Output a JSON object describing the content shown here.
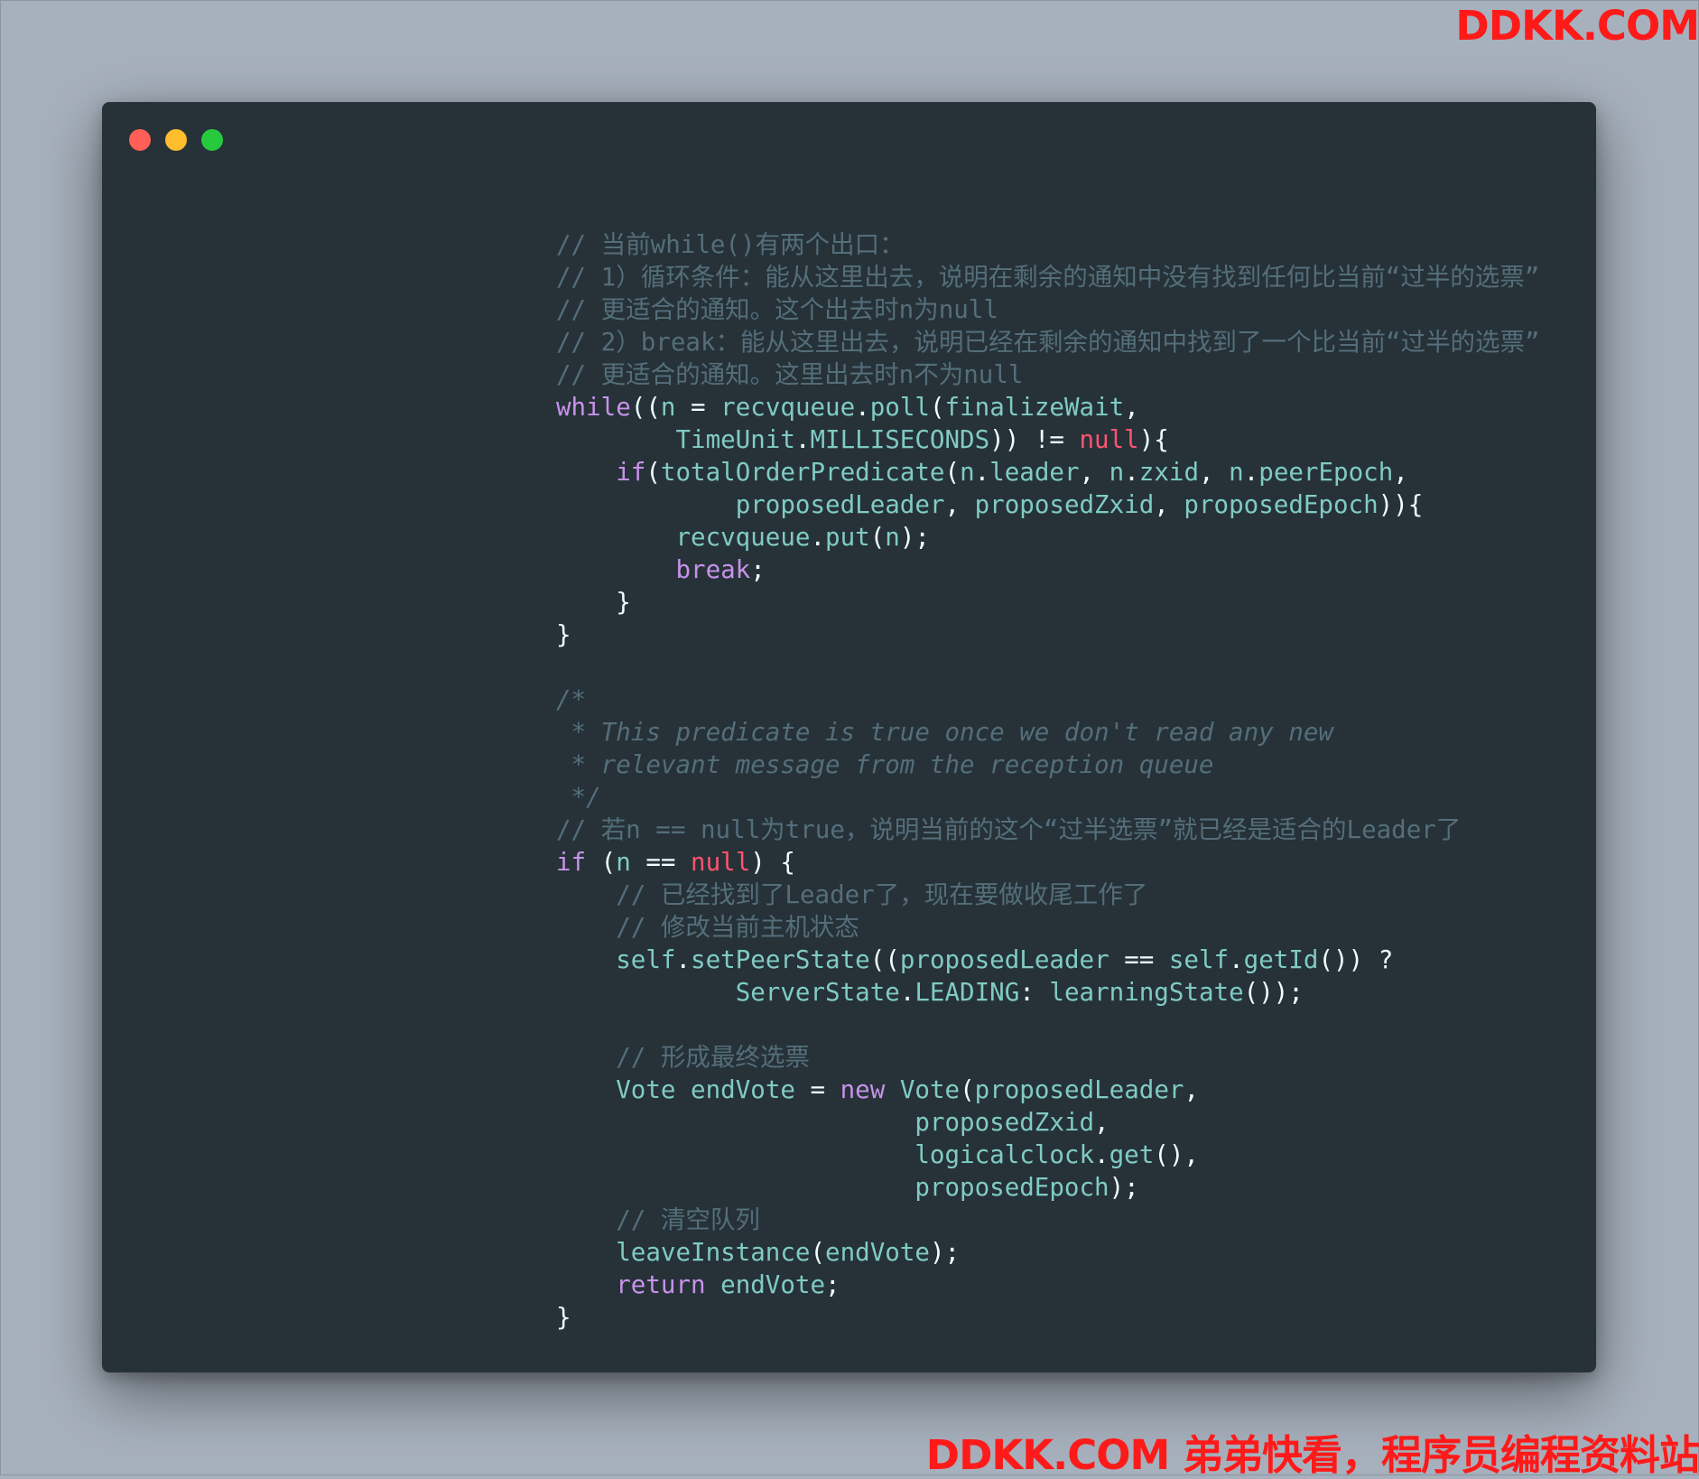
{
  "watermark": {
    "top": "DDKK.COM",
    "bottom": "DDKK.COM 弟弟快看，程序员编程资料站"
  },
  "window": {
    "background": "#263238",
    "traffic_lights": [
      "close",
      "minimize",
      "maximize"
    ]
  },
  "colors": {
    "comment": "#546e7a",
    "keyword": "#c792ea",
    "identifier": "#80cbc4",
    "null_literal": "#ff5370",
    "punctuation": "#eeffff"
  },
  "code_lines": [
    [
      {
        "t": "// 当前while()有两个出口：",
        "k": "c"
      }
    ],
    [
      {
        "t": "// 1）循环条件：能从这里出去，说明在剩余的通知中没有找到任何比当前“过半的选票”",
        "k": "c"
      }
    ],
    [
      {
        "t": "// 更适合的通知。这个出去时n为null",
        "k": "c"
      }
    ],
    [
      {
        "t": "// 2）break：能从这里出去，说明已经在剩余的通知中找到了一个比当前“过半的选票”",
        "k": "c"
      }
    ],
    [
      {
        "t": "// 更适合的通知。这里出去时n不为null",
        "k": "c"
      }
    ],
    [
      {
        "t": "while",
        "k": "kw"
      },
      {
        "t": "((",
        "k": "pn"
      },
      {
        "t": "n",
        "k": "id"
      },
      {
        "t": " = ",
        "k": "pn"
      },
      {
        "t": "recvqueue",
        "k": "id"
      },
      {
        "t": ".",
        "k": "pn"
      },
      {
        "t": "poll",
        "k": "id"
      },
      {
        "t": "(",
        "k": "pn"
      },
      {
        "t": "finalizeWait",
        "k": "id"
      },
      {
        "t": ",",
        "k": "pn"
      }
    ],
    [
      {
        "t": "        ",
        "k": "pn"
      },
      {
        "t": "TimeUnit",
        "k": "id"
      },
      {
        "t": ".",
        "k": "pn"
      },
      {
        "t": "MILLISECONDS",
        "k": "id"
      },
      {
        "t": ")) != ",
        "k": "pn"
      },
      {
        "t": "null",
        "k": "nl"
      },
      {
        "t": "){",
        "k": "pn"
      }
    ],
    [
      {
        "t": "    ",
        "k": "pn"
      },
      {
        "t": "if",
        "k": "kw"
      },
      {
        "t": "(",
        "k": "pn"
      },
      {
        "t": "totalOrderPredicate",
        "k": "id"
      },
      {
        "t": "(",
        "k": "pn"
      },
      {
        "t": "n",
        "k": "id"
      },
      {
        "t": ".",
        "k": "pn"
      },
      {
        "t": "leader",
        "k": "id"
      },
      {
        "t": ", ",
        "k": "pn"
      },
      {
        "t": "n",
        "k": "id"
      },
      {
        "t": ".",
        "k": "pn"
      },
      {
        "t": "zxid",
        "k": "id"
      },
      {
        "t": ", ",
        "k": "pn"
      },
      {
        "t": "n",
        "k": "id"
      },
      {
        "t": ".",
        "k": "pn"
      },
      {
        "t": "peerEpoch",
        "k": "id"
      },
      {
        "t": ",",
        "k": "pn"
      }
    ],
    [
      {
        "t": "            ",
        "k": "pn"
      },
      {
        "t": "proposedLeader",
        "k": "id"
      },
      {
        "t": ", ",
        "k": "pn"
      },
      {
        "t": "proposedZxid",
        "k": "id"
      },
      {
        "t": ", ",
        "k": "pn"
      },
      {
        "t": "proposedEpoch",
        "k": "id"
      },
      {
        "t": ")){",
        "k": "pn"
      }
    ],
    [
      {
        "t": "        ",
        "k": "pn"
      },
      {
        "t": "recvqueue",
        "k": "id"
      },
      {
        "t": ".",
        "k": "pn"
      },
      {
        "t": "put",
        "k": "id"
      },
      {
        "t": "(",
        "k": "pn"
      },
      {
        "t": "n",
        "k": "id"
      },
      {
        "t": ");",
        "k": "pn"
      }
    ],
    [
      {
        "t": "        ",
        "k": "pn"
      },
      {
        "t": "break",
        "k": "kw"
      },
      {
        "t": ";",
        "k": "pn"
      }
    ],
    [
      {
        "t": "    }",
        "k": "pn"
      }
    ],
    [
      {
        "t": "}",
        "k": "pn"
      }
    ],
    [],
    [
      {
        "t": "/*",
        "k": "c-it"
      }
    ],
    [
      {
        "t": " * This predicate is true once we don't read any new",
        "k": "c-it"
      }
    ],
    [
      {
        "t": " * relevant message from the reception queue",
        "k": "c-it"
      }
    ],
    [
      {
        "t": " */",
        "k": "c-it"
      }
    ],
    [
      {
        "t": "// 若n == null为true，说明当前的这个“过半选票”就已经是适合的Leader了",
        "k": "c"
      }
    ],
    [
      {
        "t": "if",
        "k": "kw"
      },
      {
        "t": " (",
        "k": "pn"
      },
      {
        "t": "n",
        "k": "id"
      },
      {
        "t": " == ",
        "k": "pn"
      },
      {
        "t": "null",
        "k": "nl"
      },
      {
        "t": ") {",
        "k": "pn"
      }
    ],
    [
      {
        "t": "    ",
        "k": "pn"
      },
      {
        "t": "// 已经找到了Leader了，现在要做收尾工作了",
        "k": "c"
      }
    ],
    [
      {
        "t": "    ",
        "k": "pn"
      },
      {
        "t": "// 修改当前主机状态",
        "k": "c"
      }
    ],
    [
      {
        "t": "    ",
        "k": "pn"
      },
      {
        "t": "self",
        "k": "id"
      },
      {
        "t": ".",
        "k": "pn"
      },
      {
        "t": "setPeerState",
        "k": "id"
      },
      {
        "t": "((",
        "k": "pn"
      },
      {
        "t": "proposedLeader",
        "k": "id"
      },
      {
        "t": " == ",
        "k": "pn"
      },
      {
        "t": "self",
        "k": "id"
      },
      {
        "t": ".",
        "k": "pn"
      },
      {
        "t": "getId",
        "k": "id"
      },
      {
        "t": "()) ?",
        "k": "pn"
      }
    ],
    [
      {
        "t": "            ",
        "k": "pn"
      },
      {
        "t": "ServerState",
        "k": "id"
      },
      {
        "t": ".",
        "k": "pn"
      },
      {
        "t": "LEADING",
        "k": "id"
      },
      {
        "t": ": ",
        "k": "pn"
      },
      {
        "t": "learningState",
        "k": "id"
      },
      {
        "t": "());",
        "k": "pn"
      }
    ],
    [],
    [
      {
        "t": "    ",
        "k": "pn"
      },
      {
        "t": "// 形成最终选票",
        "k": "c"
      }
    ],
    [
      {
        "t": "    ",
        "k": "pn"
      },
      {
        "t": "Vote",
        "k": "id"
      },
      {
        "t": " ",
        "k": "pn"
      },
      {
        "t": "endVote",
        "k": "id"
      },
      {
        "t": " = ",
        "k": "pn"
      },
      {
        "t": "new",
        "k": "kw"
      },
      {
        "t": " ",
        "k": "pn"
      },
      {
        "t": "Vote",
        "k": "id"
      },
      {
        "t": "(",
        "k": "pn"
      },
      {
        "t": "proposedLeader",
        "k": "id"
      },
      {
        "t": ",",
        "k": "pn"
      }
    ],
    [
      {
        "t": "                        ",
        "k": "pn"
      },
      {
        "t": "proposedZxid",
        "k": "id"
      },
      {
        "t": ",",
        "k": "pn"
      }
    ],
    [
      {
        "t": "                        ",
        "k": "pn"
      },
      {
        "t": "logicalclock",
        "k": "id"
      },
      {
        "t": ".",
        "k": "pn"
      },
      {
        "t": "get",
        "k": "id"
      },
      {
        "t": "(),",
        "k": "pn"
      }
    ],
    [
      {
        "t": "                        ",
        "k": "pn"
      },
      {
        "t": "proposedEpoch",
        "k": "id"
      },
      {
        "t": ");",
        "k": "pn"
      }
    ],
    [
      {
        "t": "    ",
        "k": "pn"
      },
      {
        "t": "// 清空队列",
        "k": "c"
      }
    ],
    [
      {
        "t": "    ",
        "k": "pn"
      },
      {
        "t": "leaveInstance",
        "k": "id"
      },
      {
        "t": "(",
        "k": "pn"
      },
      {
        "t": "endVote",
        "k": "id"
      },
      {
        "t": ");",
        "k": "pn"
      }
    ],
    [
      {
        "t": "    ",
        "k": "pn"
      },
      {
        "t": "return",
        "k": "kw"
      },
      {
        "t": " ",
        "k": "pn"
      },
      {
        "t": "endVote",
        "k": "id"
      },
      {
        "t": ";",
        "k": "pn"
      }
    ],
    [
      {
        "t": "}",
        "k": "pn"
      }
    ]
  ]
}
